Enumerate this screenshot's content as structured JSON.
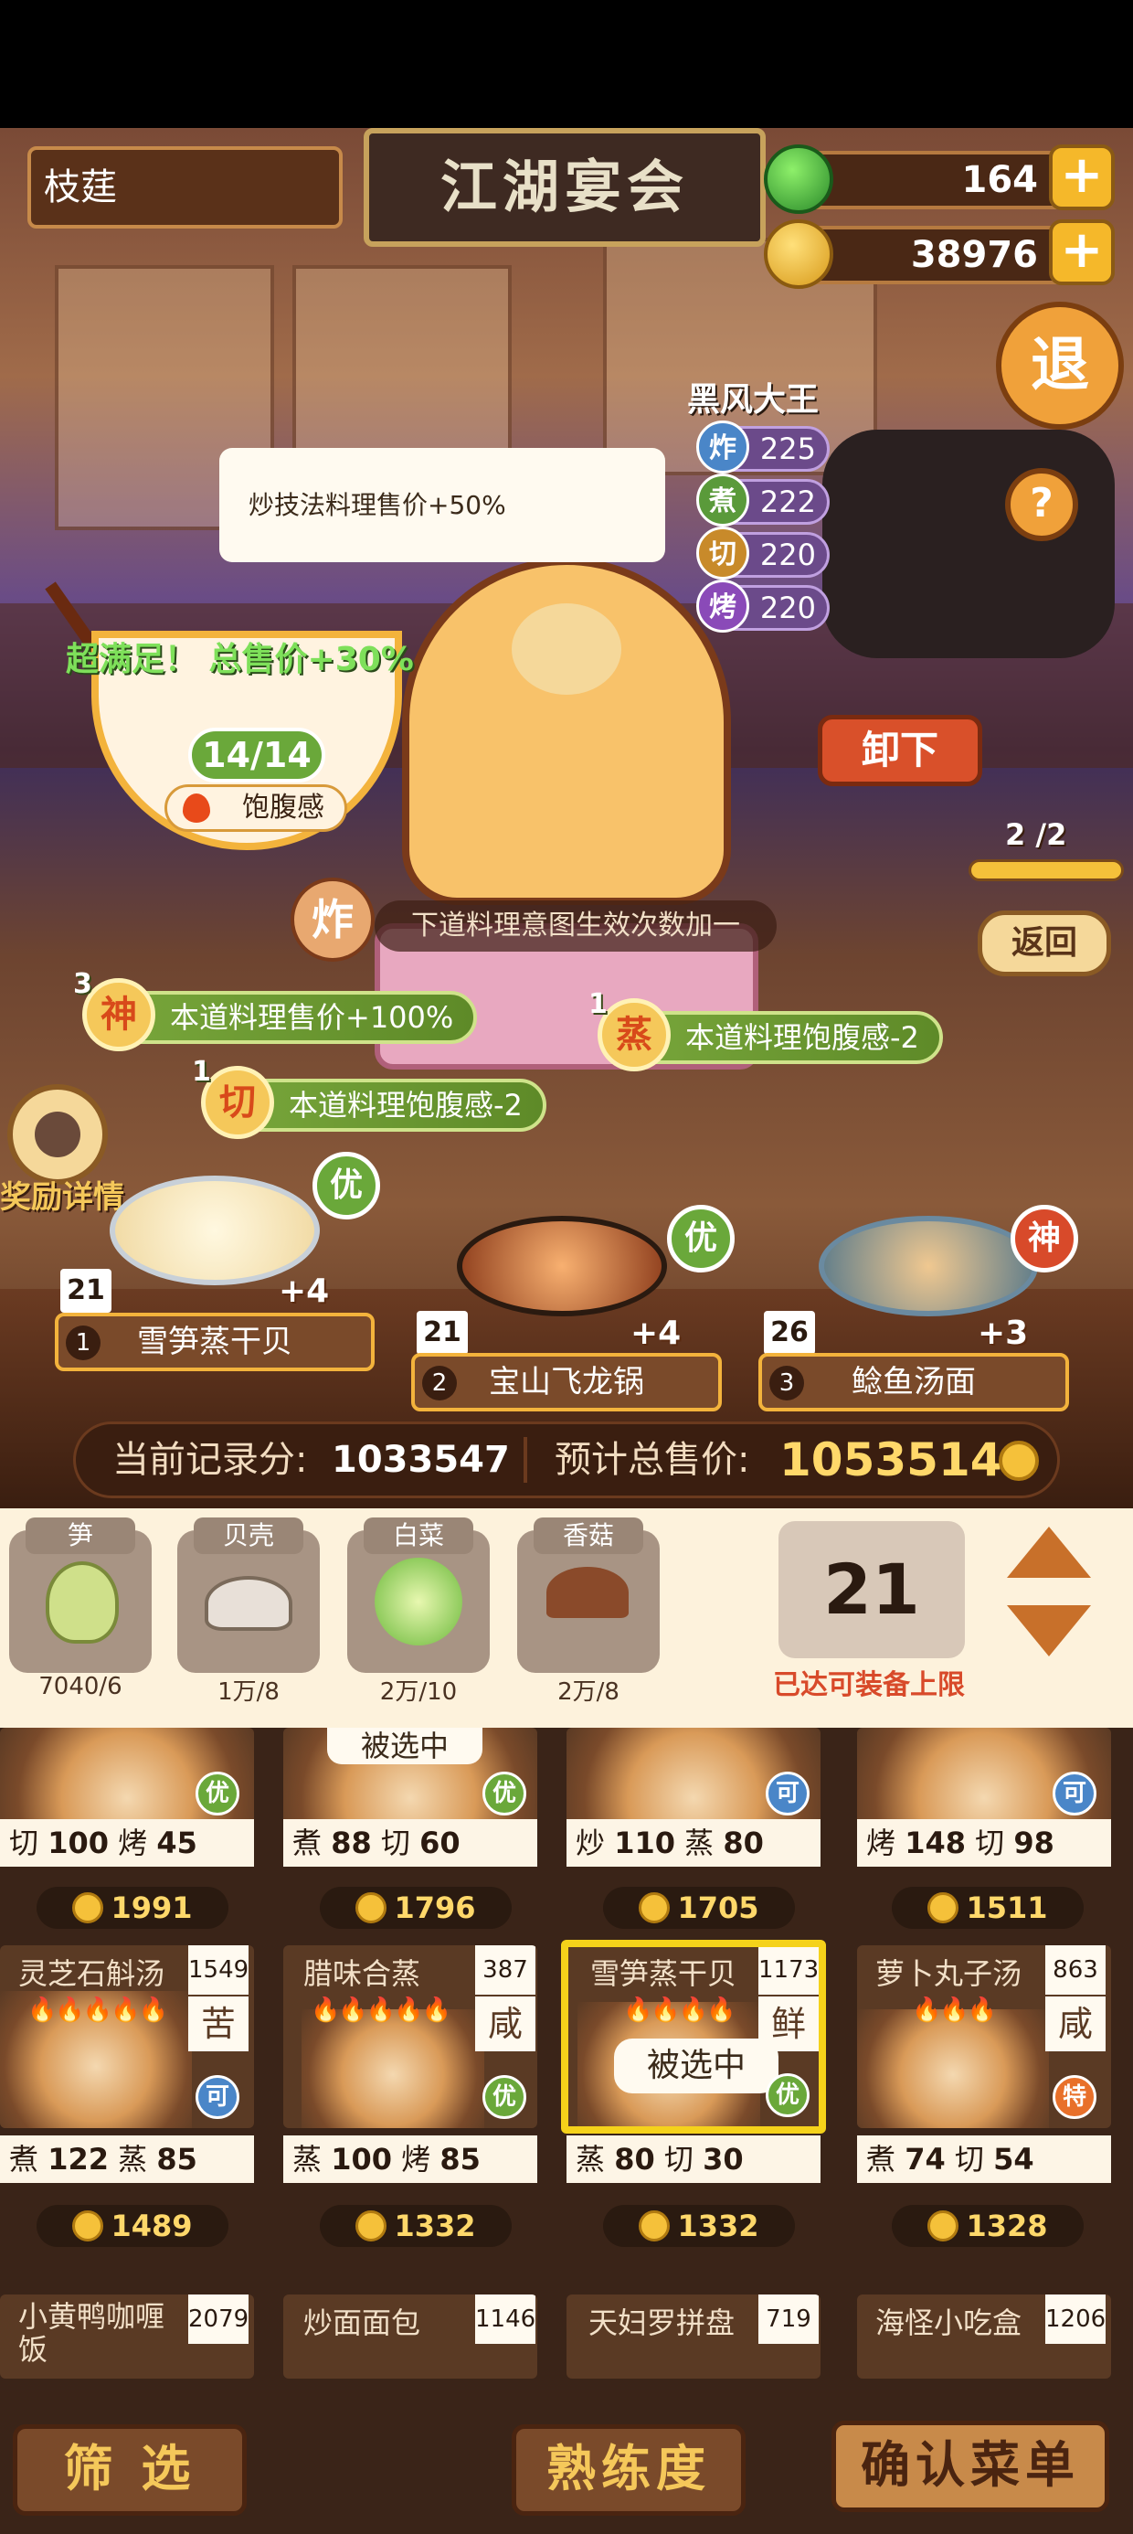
{
  "header": {
    "player_name": "枝莛",
    "title": "江湖宴会",
    "jade_count": "164",
    "coin_count": "38976",
    "plus_label": "+",
    "exit_label": "退",
    "help_label": "?"
  },
  "opponent": {
    "name": "黑风大王",
    "stats": [
      {
        "skill": "炸",
        "value": "225",
        "color": "#4a86c8"
      },
      {
        "skill": "煮",
        "value": "222",
        "color": "#5a9a3a"
      },
      {
        "skill": "切",
        "value": "220",
        "color": "#c88a2a"
      },
      {
        "skill": "烤",
        "value": "220",
        "color": "#8a4ab8"
      }
    ]
  },
  "tooltip": {
    "text": "炒技法料理售价+50%"
  },
  "satisfaction": {
    "bonus_text": "超满足！ 总售价+30%",
    "fullness_value": "14/14",
    "fullness_label": "饱腹感"
  },
  "controls": {
    "unload_label": "卸下",
    "page_indicator": "2 /2",
    "back_label": "返回",
    "reward_label": "奖励详情"
  },
  "effects": {
    "hint_char": "炸",
    "hint_text": "下道料理意图生效次数加一",
    "skills": [
      {
        "badge": "神",
        "count": "3",
        "text": "本道料理售价+100%"
      },
      {
        "badge": "切",
        "count": "1",
        "text": "本道料理饱腹感-2"
      },
      {
        "badge": "蒸",
        "count": "1",
        "text": "本道料理饱腹感-2"
      }
    ]
  },
  "selected_dishes": [
    {
      "slot": "1",
      "name": "雪笋蒸干贝",
      "level": "21",
      "grade": "优",
      "fire": "+4"
    },
    {
      "slot": "2",
      "name": "宝山飞龙锅",
      "level": "21",
      "grade": "优",
      "fire": "+4"
    },
    {
      "slot": "3",
      "name": "鲶鱼汤面",
      "level": "26",
      "grade": "神",
      "fire": "+3"
    }
  ],
  "score": {
    "record_label": "当前记录分:",
    "record_value": "1033547",
    "estimate_label": "预计总售价:",
    "estimate_value": "1053514"
  },
  "ingredients": [
    {
      "label": "笋",
      "count": "7040/6"
    },
    {
      "label": "贝壳",
      "count": "1万/8"
    },
    {
      "label": "白菜",
      "count": "2万/10"
    },
    {
      "label": "香菇",
      "count": "2万/8"
    }
  ],
  "equip": {
    "count": "21",
    "limit_text": "已达可装备上限"
  },
  "dish_grid": {
    "row1": [
      {
        "grade": "优",
        "a1": "切",
        "v1": "100",
        "a2": "烤",
        "v2": "45",
        "price": "1991"
      },
      {
        "grade": "优",
        "a1": "煮",
        "v1": "88",
        "a2": "切",
        "v2": "60",
        "price": "1796",
        "badge": "被选中"
      },
      {
        "grade": "可",
        "a1": "炒",
        "v1": "110",
        "a2": "蒸",
        "v2": "80",
        "price": "1705"
      },
      {
        "grade": "可",
        "a1": "烤",
        "v1": "148",
        "a2": "切",
        "v2": "98",
        "price": "1511"
      }
    ],
    "row2": [
      {
        "name": "灵芝石斛汤",
        "num": "1549",
        "taste": "苦",
        "grade": "可",
        "a1": "煮",
        "v1": "122",
        "a2": "蒸",
        "v2": "85",
        "price": "1489"
      },
      {
        "name": "腊味合蒸",
        "num": "387",
        "taste": "咸",
        "grade": "优",
        "a1": "蒸",
        "v1": "100",
        "a2": "烤",
        "v2": "85",
        "price": "1332"
      },
      {
        "name": "雪笋蒸干贝",
        "num": "1173",
        "taste": "鲜",
        "grade": "优",
        "a1": "蒸",
        "v1": "80",
        "a2": "切",
        "v2": "30",
        "price": "1332",
        "badge": "被选中"
      },
      {
        "name": "萝卜丸子汤",
        "num": "863",
        "taste": "咸",
        "grade": "特",
        "a1": "煮",
        "v1": "74",
        "a2": "切",
        "v2": "54",
        "price": "1328"
      }
    ],
    "row3": [
      {
        "name": "小黄鸭咖喱饭",
        "num": "2079"
      },
      {
        "name": "炒面面包",
        "num": "1146"
      },
      {
        "name": "天妇罗拼盘",
        "num": "719"
      },
      {
        "name": "海怪小吃盒",
        "num": "1206"
      }
    ]
  },
  "bottom": {
    "filter_label": "筛 选",
    "skill_label": "熟练度",
    "confirm_label": "确认菜单"
  },
  "colors": {
    "accent_gold": "#f5b82a",
    "grade_you": "#6aa83a",
    "grade_shen": "#d84a2a",
    "grade_ke": "#4a86c8",
    "grade_te": "#e8702a"
  }
}
